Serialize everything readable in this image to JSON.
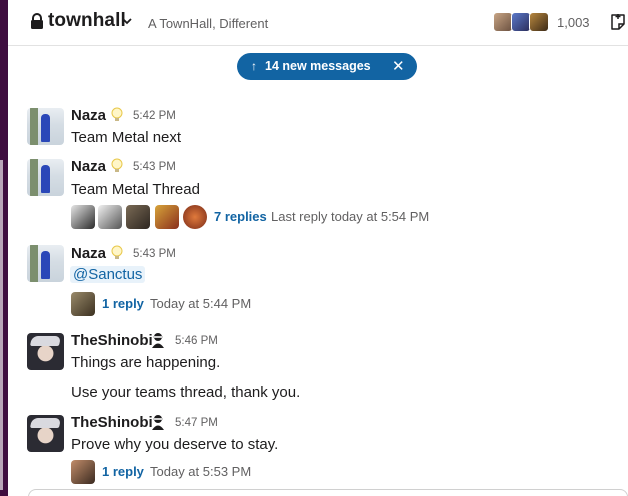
{
  "header": {
    "channel_name": "townhall",
    "topic": "A TownHall, Different",
    "member_count": "1,003",
    "icons": {
      "lock": "lock-icon",
      "chevron": "chevron-down-icon",
      "canvas": "canvas-icon"
    }
  },
  "new_messages": {
    "arrow": "↑",
    "label": "14 new messages",
    "close": "✕"
  },
  "messages": [
    {
      "sender": "Naza",
      "status": "lightbulb-icon",
      "time": "5:42 PM",
      "text": "Team Metal next"
    },
    {
      "sender": "Naza",
      "status": "lightbulb-icon",
      "time": "5:43 PM",
      "text": "Team Metal Thread",
      "thread": {
        "replies": "7 replies",
        "meta": "Last reply today at 5:54 PM"
      }
    },
    {
      "sender": "Naza",
      "status": "lightbulb-icon",
      "time": "5:43 PM",
      "text": "@Sanctus",
      "thread": {
        "replies": "1 reply",
        "meta": "Today at 5:44 PM"
      }
    },
    {
      "sender": "TheShinobi",
      "status": "ninja-icon",
      "time": "5:46 PM",
      "text": "Things are happening.",
      "text2": "Use your teams thread, thank you."
    },
    {
      "sender": "TheShinobi",
      "status": "ninja-icon",
      "time": "5:47 PM",
      "text": "Prove why you deserve to stay.",
      "thread": {
        "replies": "1 reply",
        "meta": "Today at 5:53 PM"
      }
    }
  ],
  "colors": {
    "link": "#1264a3",
    "pill": "#1264a3",
    "sidebar": "#3f0e40",
    "muted": "#616061"
  }
}
